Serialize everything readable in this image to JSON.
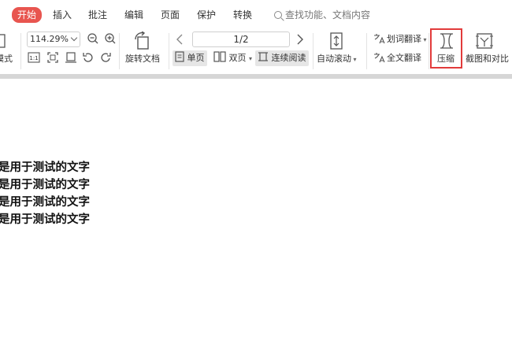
{
  "menu": {
    "tabs": [
      "开始",
      "插入",
      "批注",
      "编辑",
      "页面",
      "保护",
      "转换"
    ],
    "search_placeholder": "查找功能、文档内容"
  },
  "toolbar": {
    "left_partial_label": "模式",
    "zoom_value": "114.29%",
    "fit_label": "1:1",
    "rotate_doc_label": "旋转文档",
    "page_indicator": "1/2",
    "single_page_label": "单页",
    "double_page_label": "双页",
    "continuous_label": "连续阅读",
    "auto_scroll_label": "自动滚动",
    "word_translate_label": "划词翻译",
    "full_translate_label": "全文翻译",
    "compress_label": "压缩",
    "screenshot_compare_label": "截图和对比"
  },
  "document": {
    "lines": [
      "是用于测试的文字",
      "是用于测试的文字",
      "是用于测试的文字",
      "是用于测试的文字"
    ]
  },
  "colors": {
    "active_tab": "#e8554f",
    "highlight": "#e23b3b"
  }
}
